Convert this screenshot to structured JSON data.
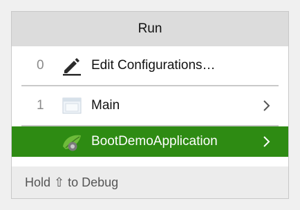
{
  "popup": {
    "title": "Run",
    "items": [
      {
        "number": "0",
        "label": "Edit Configurations…",
        "icon": "pencil-icon",
        "has_submenu": false,
        "selected": false
      },
      {
        "number": "1",
        "label": "Main",
        "icon": "window-icon",
        "has_submenu": true,
        "selected": false
      },
      {
        "number": "",
        "label": "BootDemoApplication",
        "icon": "spring-boot-icon",
        "has_submenu": true,
        "selected": true
      }
    ],
    "footer_text": "Hold ⇧ to Debug"
  },
  "colors": {
    "selected_bg": "#2e8b13",
    "header_bg": "#dcdcdc",
    "footer_bg": "#ececec"
  }
}
